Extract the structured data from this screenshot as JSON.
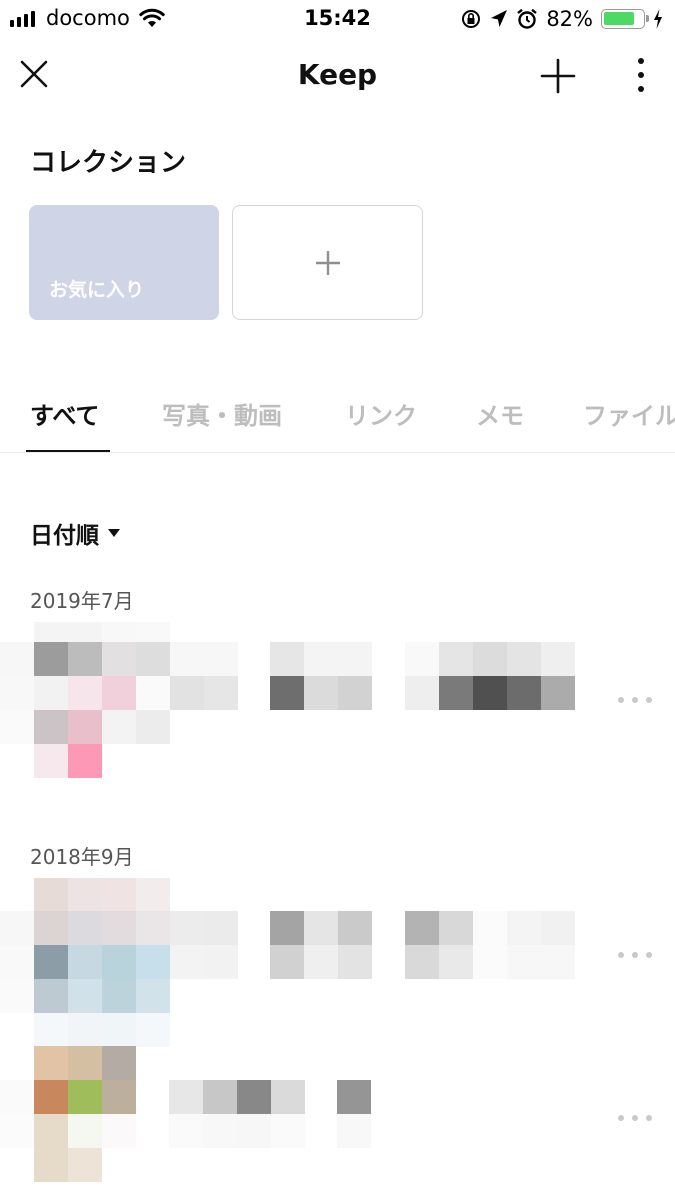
{
  "status_bar": {
    "carrier": "docomo",
    "time": "15:42",
    "battery_percent": "82%",
    "battery_level": 0.82,
    "icons": [
      "signal-icon",
      "wifi-icon",
      "rotation-lock-icon",
      "location-icon",
      "alarm-icon",
      "battery-icon",
      "charging-icon"
    ]
  },
  "header": {
    "title": "Keep",
    "icons": [
      "close-icon",
      "add-icon",
      "more-vertical-icon"
    ]
  },
  "collections": {
    "title": "コレクション",
    "items": [
      {
        "label": "お気に入り",
        "color": "#cfd5e6"
      }
    ],
    "add_icon": "plus-icon"
  },
  "tabs": [
    {
      "label": "すべて",
      "active": true
    },
    {
      "label": "写真・動画",
      "active": false
    },
    {
      "label": "リンク",
      "active": false
    },
    {
      "label": "メモ",
      "active": false
    },
    {
      "label": "ファイル",
      "active": false
    }
  ],
  "sort": {
    "label": "日付順",
    "icon": "caret-down-icon"
  },
  "groups": [
    {
      "date": "2019年7月"
    },
    {
      "date": "2018年9月"
    }
  ],
  "colors": {
    "accent": "#111111",
    "inactive_tab": "#bdbdbd",
    "collection_card": "#cfd5e6",
    "battery": "#4cd964"
  }
}
